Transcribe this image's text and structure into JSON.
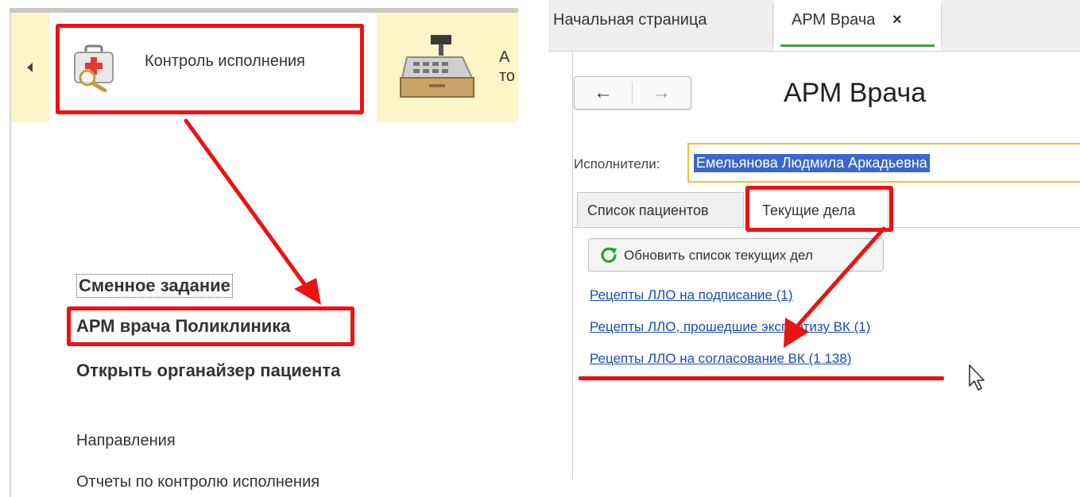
{
  "left_panel": {
    "nav_items": [
      {
        "label": "Контроль исполнения",
        "icon": "medkit-icon"
      },
      {
        "label": "А\nто",
        "icon": "cash-register-icon"
      }
    ],
    "menu": {
      "shift_task": "Сменное задание",
      "arm_polyclinic": "АРМ врача Поликлиника",
      "open_organizer": "Открыть органайзер пациента",
      "directions": "Направления",
      "reports": "Отчеты по контролю исполнения"
    }
  },
  "right_panel": {
    "tabs": [
      {
        "label": "Начальная страница"
      },
      {
        "label": "АРМ Врача",
        "close": "×"
      }
    ],
    "nav": {
      "back": "←",
      "forward": "→"
    },
    "title": "АРМ Врача",
    "executors_label": "Исполнители:",
    "executors_value": "Емельянова Людмила Аркадьевна",
    "panel_tabs": [
      {
        "label": "Список пациентов"
      },
      {
        "label": "Текущие дела"
      }
    ],
    "refresh_button": "Обновить список текущих дел",
    "links": [
      "Рецепты ЛЛО на подписание (1)",
      "Рецепты ЛЛО, прошедшие экспертизу ВК (1)",
      "Рецепты ЛЛО на согласование ВК (1 138)"
    ]
  },
  "colors": {
    "highlight_red": "#ee1111",
    "nav_bar_yellow": "#fbf5c7",
    "field_border": "#f1c232",
    "selection_blue": "#3a67c9",
    "link_blue": "#1b4cb0",
    "active_tab_green": "#43a047"
  }
}
